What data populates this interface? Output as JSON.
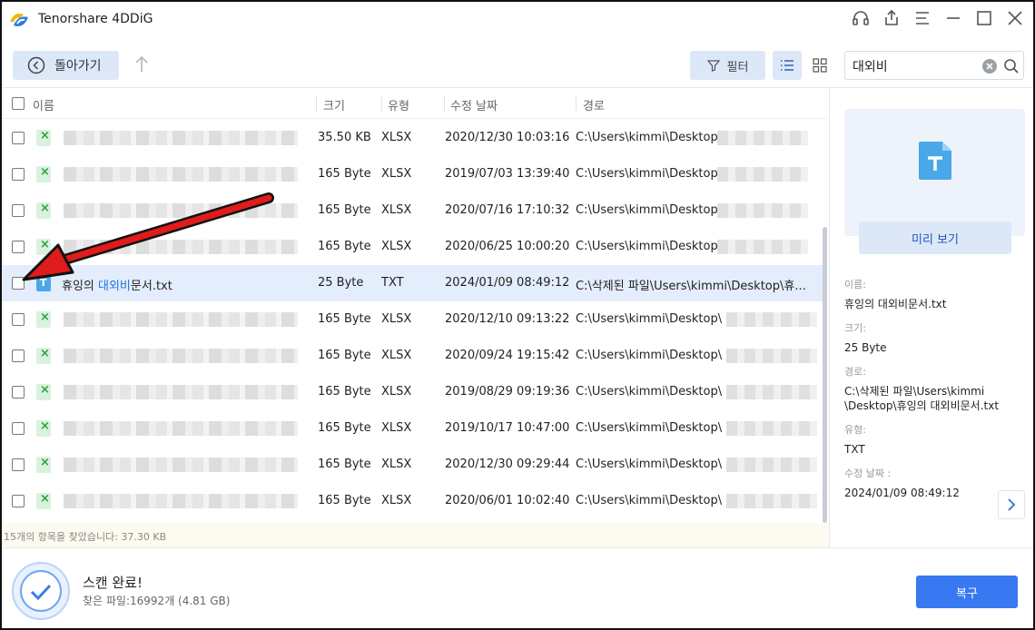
{
  "app": {
    "title": "Tenorshare 4DDiG"
  },
  "window_controls": [
    "headset-icon",
    "share-icon",
    "menu-icon",
    "minimize-icon",
    "maximize-icon",
    "close-icon"
  ],
  "toolbar": {
    "back_label": "돌아가기",
    "filter_label": "필터",
    "search_value": "대외비"
  },
  "table": {
    "headers": {
      "name": "이름",
      "size": "크기",
      "type": "유형",
      "modified": "수정 날짜",
      "path": "경로"
    },
    "rows": [
      {
        "size": "35.50 KB",
        "type": "XLSX",
        "modified": "2020/12/30 10:03:16",
        "path": "C:\\Users\\kimmi\\Desktop",
        "icon": "xlsx"
      },
      {
        "size": "165 Byte",
        "type": "XLSX",
        "modified": "2019/07/03 13:39:40",
        "path": "C:\\Users\\kimmi\\Desktop",
        "icon": "xlsx"
      },
      {
        "size": "165 Byte",
        "type": "XLSX",
        "modified": "2020/07/16 17:10:32",
        "path": "C:\\Users\\kimmi\\Desktop",
        "icon": "xlsx"
      },
      {
        "size": "165 Byte",
        "type": "XLSX",
        "modified": "2020/06/25 10:00:20",
        "path": "C:\\Users\\kimmi\\Desktop",
        "icon": "xlsx"
      },
      {
        "name_pre": "휴잉의 ",
        "name_hl": "대외비",
        "name_post": "문서.txt",
        "size": "25 Byte",
        "type": "TXT",
        "modified": "2024/01/09 08:49:12",
        "path": "C:\\삭제된 파일\\Users\\kimmi\\Desktop\\휴...",
        "icon": "txt",
        "selected": true
      },
      {
        "size": "165 Byte",
        "type": "XLSX",
        "modified": "2020/12/10 09:13:22",
        "path": "C:\\Users\\kimmi\\Desktop\\",
        "icon": "xlsx"
      },
      {
        "size": "165 Byte",
        "type": "XLSX",
        "modified": "2020/09/24 19:15:42",
        "path": "C:\\Users\\kimmi\\Desktop\\",
        "icon": "xlsx"
      },
      {
        "size": "165 Byte",
        "type": "XLSX",
        "modified": "2019/08/29 09:19:36",
        "path": "C:\\Users\\kimmi\\Desktop\\",
        "icon": "xlsx"
      },
      {
        "size": "165 Byte",
        "type": "XLSX",
        "modified": "2019/10/17 10:47:00",
        "path": "C:\\Users\\kimmi\\Desktop\\",
        "icon": "xlsx"
      },
      {
        "size": "165 Byte",
        "type": "XLSX",
        "modified": "2020/12/30 09:29:44",
        "path": "C:\\Users\\kimmi\\Desktop\\",
        "icon": "xlsx"
      },
      {
        "size": "165 Byte",
        "type": "XLSX",
        "modified": "2020/06/01 10:02:40",
        "path": "C:\\Users\\kimmi\\Desktop\\",
        "icon": "xlsx"
      }
    ],
    "status": "15개의 항목을 찾았습니다: 37.30 KB"
  },
  "preview": {
    "button_label": "미리 보기",
    "name_label": "이름:",
    "name_value": "휴잉의 대외비문서.txt",
    "size_label": "크기:",
    "size_value": "25 Byte",
    "path_label": "경로:",
    "path_value_1": "C:\\삭제된 파일\\Users\\kimmi",
    "path_value_2": "\\Desktop\\휴잉의 대외비문서.txt",
    "type_label": "유형:",
    "type_value": "TXT",
    "modified_label": "수정 날짜 :",
    "modified_value": "2024/01/09 08:49:12"
  },
  "footer": {
    "scan_title": "스캔 완료!",
    "scan_sub": "찾은 파일:16992개 (4.81 GB)",
    "recover_label": "복구"
  },
  "colors": {
    "accent": "#3878f0",
    "light_accent": "#dce8f8",
    "selected_row": "#e4edfb",
    "annotation_arrow": "#e01b1b"
  }
}
